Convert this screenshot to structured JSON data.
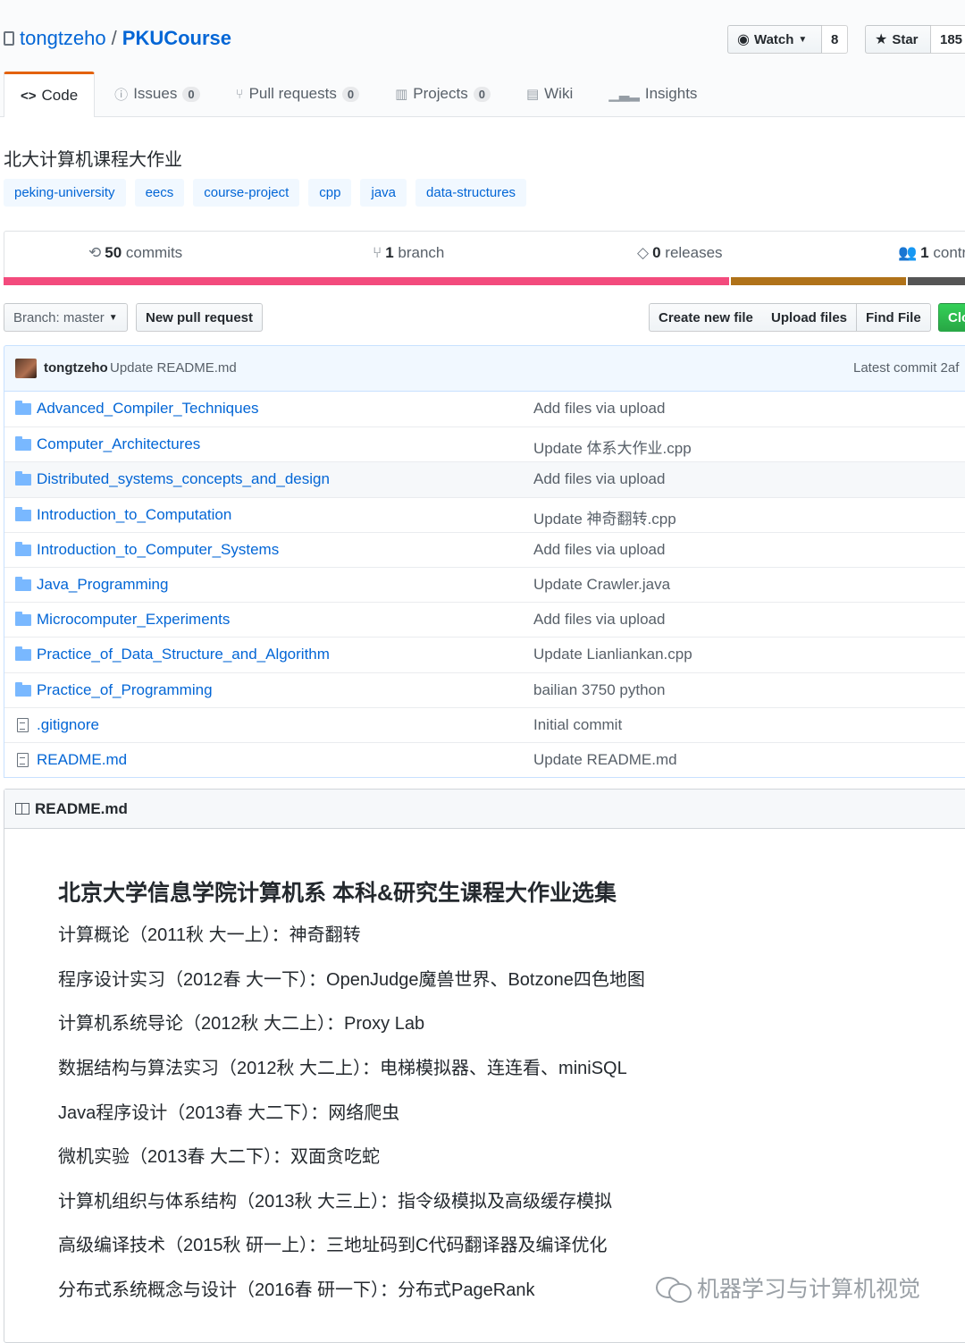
{
  "repo": {
    "owner": "tongtzeho",
    "separator": "/",
    "name": "PKUCourse"
  },
  "actions": {
    "watch_label": "Watch",
    "watch_count": "8",
    "star_label": "Star",
    "star_count": "185"
  },
  "tabs": [
    {
      "label": "Code",
      "icon": "code-icon"
    },
    {
      "label": "Issues",
      "count": "0",
      "icon": "issue-icon"
    },
    {
      "label": "Pull requests",
      "count": "0",
      "icon": "pull-request-icon"
    },
    {
      "label": "Projects",
      "count": "0",
      "icon": "project-icon"
    },
    {
      "label": "Wiki",
      "icon": "book-icon"
    },
    {
      "label": "Insights",
      "icon": "graph-icon"
    }
  ],
  "description": "北大计算机课程大作业",
  "topics": [
    "peking-university",
    "eecs",
    "course-project",
    "cpp",
    "java",
    "data-structures"
  ],
  "stats": {
    "commits_num": "50",
    "commits_label": "commits",
    "branch_num": "1",
    "branch_label": "branch",
    "releases_num": "0",
    "releases_label": "releases",
    "contrib_num": "1",
    "contrib_label": "contr"
  },
  "language_colors": [
    "#f34b7d",
    "#b07219",
    "#555555"
  ],
  "language_shares": [
    74.5,
    18.2,
    7.3
  ],
  "file_nav": {
    "branch_label": "Branch: master",
    "new_pr": "New pull request",
    "create_file": "Create new file",
    "upload_files": "Upload files",
    "find_file": "Find File",
    "clone": "Clo"
  },
  "commit": {
    "author": "tongtzeho",
    "message": "Update README.md",
    "latest": "Latest commit 2af"
  },
  "files": [
    {
      "type": "dir",
      "name": "Advanced_Compiler_Techniques",
      "message": "Add files via upload"
    },
    {
      "type": "dir",
      "name": "Computer_Architectures",
      "message": "Update 体系大作业.cpp"
    },
    {
      "type": "dir",
      "name": "Distributed_systems_concepts_and_design",
      "message": "Add files via upload"
    },
    {
      "type": "dir",
      "name": "Introduction_to_Computation",
      "message": "Update 神奇翻转.cpp"
    },
    {
      "type": "dir",
      "name": "Introduction_to_Computer_Systems",
      "message": "Add files via upload"
    },
    {
      "type": "dir",
      "name": "Java_Programming",
      "message": "Update Crawler.java"
    },
    {
      "type": "dir",
      "name": "Microcomputer_Experiments",
      "message": "Add files via upload"
    },
    {
      "type": "dir",
      "name": "Practice_of_Data_Structure_and_Algorithm",
      "message": "Update Lianliankan.cpp"
    },
    {
      "type": "dir",
      "name": "Practice_of_Programming",
      "message": "bailian 3750 python"
    },
    {
      "type": "file",
      "name": ".gitignore",
      "message": "Initial commit"
    },
    {
      "type": "file",
      "name": "README.md",
      "message": "Update README.md"
    }
  ],
  "readme": {
    "filename": "README.md",
    "heading": "北京大学信息学院计算机系 本科&研究生课程大作业选集",
    "lines": [
      "计算概论（2011秋 大一上）：神奇翻转",
      "程序设计实习（2012春 大一下）：OpenJudge魔兽世界、Botzone四色地图",
      "计算机系统导论（2012秋 大二上）：Proxy Lab",
      "数据结构与算法实习（2012秋 大二上）：电梯模拟器、连连看、miniSQL",
      "Java程序设计（2013春 大二下）：网络爬虫",
      "微机实验（2013春 大二下）：双面贪吃蛇",
      "计算机组织与体系结构（2013秋 大三上）：指令级模拟及高级缓存模拟",
      "高级编译技术（2015秋 研一上）：三地址码到C代码翻译器及编译优化",
      "分布式系统概念与设计（2016春 研一下）：分布式PageRank"
    ]
  },
  "watermark": "机器学习与计算机视觉"
}
